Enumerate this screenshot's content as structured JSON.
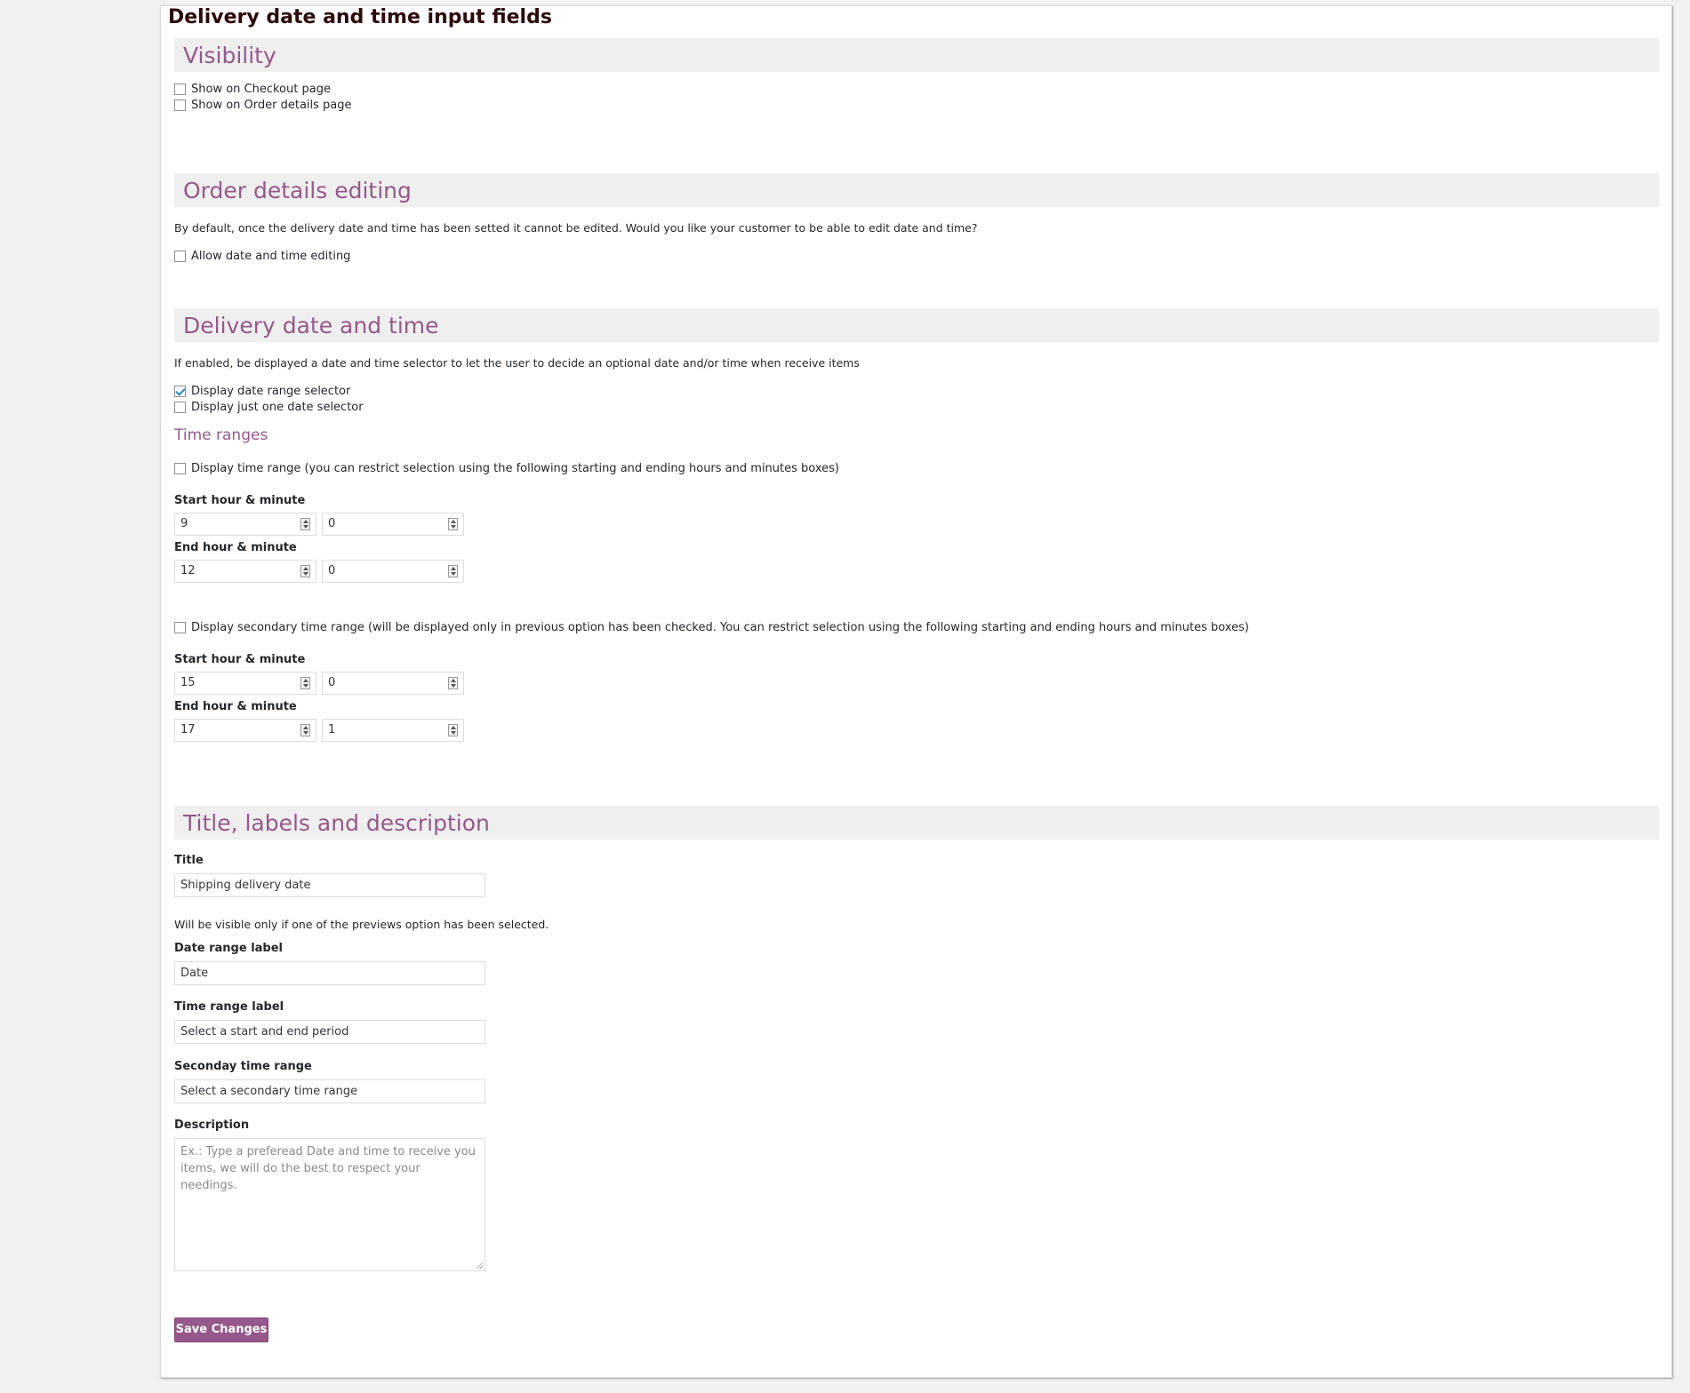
{
  "page": {
    "title": "Delivery date and time input fields"
  },
  "visibility": {
    "heading": "Visibility",
    "checkout_label": "Show on Checkout page",
    "checkout_checked": false,
    "order_details_label": "Show on Order details page",
    "order_details_checked": false
  },
  "editing": {
    "heading": "Order details editing",
    "description": "By default, once the delivery date and time has been setted it cannot be edited. Would you like your customer to be able to edit date and time?",
    "allow_label": "Allow date and time editing",
    "allow_checked": false
  },
  "delivery": {
    "heading": "Delivery date and time",
    "description": "If enabled, be displayed a date and time selector to let the user to decide an optional date and/or time when receive items",
    "range_selector_label": "Display date range selector",
    "range_selector_checked": true,
    "single_selector_label": "Display just one date selector",
    "single_selector_checked": false,
    "time_ranges_heading": "Time ranges",
    "primary": {
      "toggle_label": "Display time range (you can restrict selection using the following starting and ending hours and minutes boxes)",
      "start_label": "Start hour & minute",
      "start_hour": "9",
      "start_minute": "0",
      "end_label": "End hour & minute",
      "end_hour": "12",
      "end_minute": "0"
    },
    "secondary": {
      "toggle_label": "Display secondary time range (will be displayed only in previous option has been checked. You can restrict selection using the following starting and ending hours and minutes boxes)",
      "start_label": "Start hour & minute",
      "start_hour": "15",
      "start_minute": "0",
      "end_label": "End hour & minute",
      "end_hour": "17",
      "end_minute": "1"
    }
  },
  "labels": {
    "heading": "Title, labels and description",
    "title_label": "Title",
    "title_value": "Shipping delivery date",
    "title_hint": "Will be visible only if one of the previews option has been selected.",
    "date_range_label": "Date range label",
    "date_range_value": "Date",
    "time_range_label": "Time range label",
    "time_range_value": "Select a start and end period",
    "secondary_label": "Seconday time range",
    "secondary_value": "Select a secondary time range",
    "description_label": "Description",
    "description_placeholder": "Ex.: Type a preferead Date and time to receive you items, we will do the best to respect your needings."
  },
  "actions": {
    "save_label": "Save Changes"
  },
  "colors": {
    "accent": "#96588a",
    "section_bg": "#efefef"
  }
}
